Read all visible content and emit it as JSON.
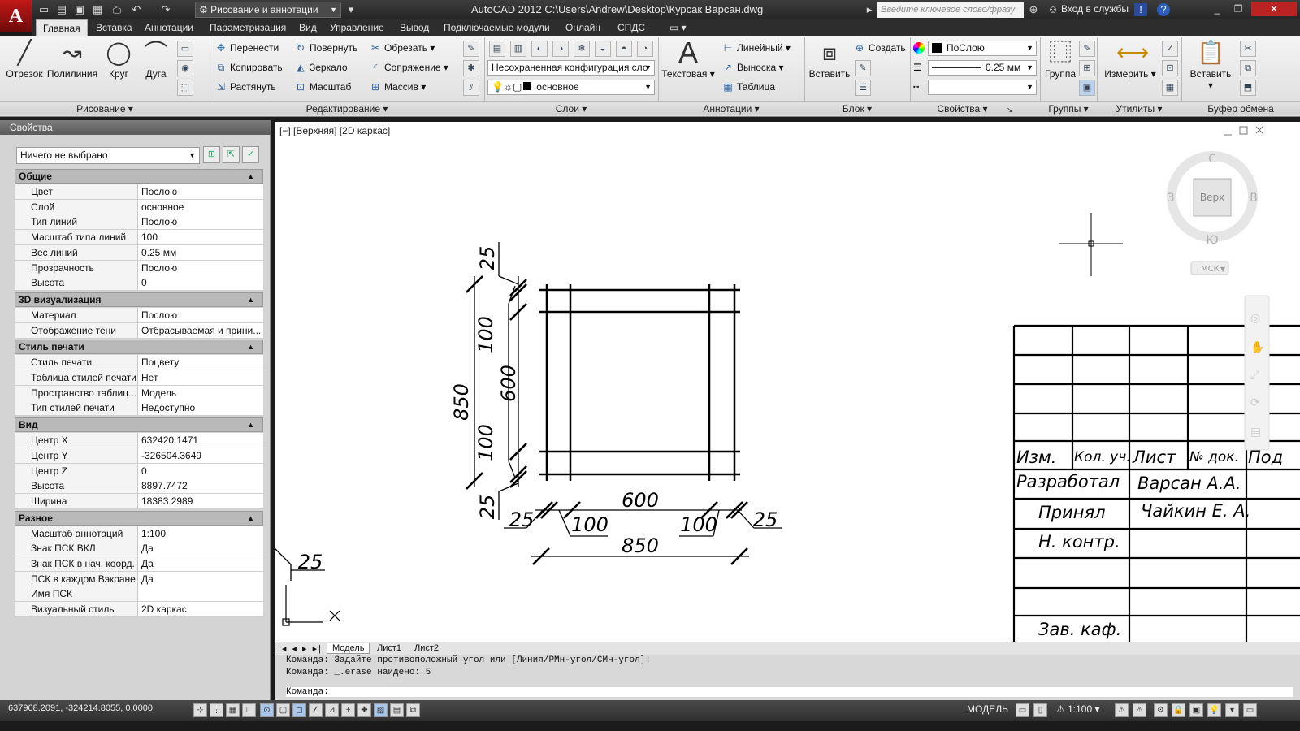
{
  "app": {
    "logo": "A",
    "title": "AutoCAD 2012    C:\\Users\\Andrew\\Desktop\\Курсак Варсан.dwg",
    "workspace": "Рисование и аннотации",
    "search_placeholder": "Введите ключевое слово/фразу",
    "sign_in": "Вход в службы"
  },
  "menu": {
    "tabs": [
      "Главная",
      "Вставка",
      "Аннотации",
      "Параметризация",
      "Вид",
      "Управление",
      "Вывод",
      "Подключаемые модули",
      "Онлайн",
      "СПДС"
    ]
  },
  "ribbon": {
    "draw": {
      "title": "Рисование",
      "line": "Отрезок",
      "polyline": "Полилиния",
      "circle": "Круг",
      "arc": "Дуга"
    },
    "modify": {
      "title": "Редактирование",
      "move": "Перенести",
      "rotate": "Повернуть",
      "trim": "Обрезать",
      "copy": "Копировать",
      "mirror": "Зеркало",
      "fillet": "Сопряжение",
      "stretch": "Растянуть",
      "scale": "Масштаб",
      "array": "Массив"
    },
    "layers": {
      "title": "Слои",
      "state": "Несохраненная конфигурация сло",
      "current": "основное"
    },
    "annotation": {
      "title": "Аннотации",
      "text": "Текстовая",
      "linear": "Линейный",
      "leader": "Выноска",
      "table": "Таблица"
    },
    "block": {
      "title": "Блок",
      "insert": "Вставить",
      "create": "Создать"
    },
    "properties": {
      "title": "Свойства",
      "color": "ПоСлою",
      "lineweight": "0.25 мм"
    },
    "groups": {
      "title": "Группы",
      "group": "Группа"
    },
    "utilities": {
      "title": "Утилиты",
      "measure": "Измерить"
    },
    "clipboard": {
      "title": "Буфер обмена",
      "paste": "Вставить"
    }
  },
  "palette": {
    "title": "Свойства",
    "selection": "Ничего не выбрано",
    "sections": [
      {
        "name": "Общие",
        "rows": [
          [
            "Цвет",
            "Послою"
          ],
          [
            "Слой",
            "основное"
          ],
          [
            "Тип линий",
            "Послою"
          ],
          [
            "Масштаб типа линий",
            "100"
          ],
          [
            "Вес линий",
            "0.25 мм"
          ],
          [
            "Прозрачность",
            "Послою"
          ],
          [
            "Высота",
            "0"
          ]
        ]
      },
      {
        "name": "3D визуализация",
        "rows": [
          [
            "Материал",
            "Послою"
          ],
          [
            "Отображение тени",
            "Отбрасываемая и прини..."
          ]
        ]
      },
      {
        "name": "Стиль печати",
        "rows": [
          [
            "Стиль печати",
            "Поцвету"
          ],
          [
            "Таблица стилей печати",
            "Нет"
          ],
          [
            "Пространство таблиц...",
            "Модель"
          ],
          [
            "Тип стилей печати",
            "Недоступно"
          ]
        ]
      },
      {
        "name": "Вид",
        "rows": [
          [
            "Центр X",
            "632420.1471"
          ],
          [
            "Центр Y",
            "-326504.3649"
          ],
          [
            "Центр Z",
            "0"
          ],
          [
            "Высота",
            "8897.7472"
          ],
          [
            "Ширина",
            "18383.2989"
          ]
        ]
      },
      {
        "name": "Разное",
        "rows": [
          [
            "Масштаб аннотаций",
            "1:100"
          ],
          [
            "Знак ПСК ВКЛ",
            "Да"
          ],
          [
            "Знак ПСК в нач. коорд.",
            "Да"
          ],
          [
            "ПСК в каждом Вэкране",
            "Да"
          ],
          [
            "Имя ПСК",
            ""
          ],
          [
            "Визуальный стиль",
            "2D каркас"
          ]
        ]
      }
    ]
  },
  "viewport": {
    "label": "[−] [Верхняя] [2D каркас]",
    "viewcube": {
      "top": "Верх",
      "north": "С",
      "south": "Ю",
      "west": "З",
      "east": "В",
      "wcs": "МСК"
    },
    "dims": {
      "left_total": "850",
      "left_mid": "600",
      "left_a": "100",
      "left_b": "100",
      "left_c": "25",
      "left_d": "25",
      "bottom_mid": "600",
      "bottom_a": "100",
      "bottom_b": "100",
      "bottom_c": "25",
      "bottom_d": "25",
      "bottom_total": "850",
      "partial": "25"
    },
    "titleblock": {
      "izm": "Изм.",
      "kol": "Кол. уч.",
      "list": "Лист",
      "doc": "№ док.",
      "pod": "Под",
      "dev_label": "Разработал",
      "dev_name": "Варсан А.А.",
      "acc_label": "Принял",
      "acc_name": "Чайкин Е. А.",
      "norm": "Н. контр.",
      "head": "Зав. каф."
    }
  },
  "layout_tabs": [
    "Модель",
    "Лист1",
    "Лист2"
  ],
  "command": {
    "lines": [
      "Команда: Задайте противоположный угол или [Линия/РМн-угол/СМн-угол]:",
      "Команда: _.erase найдено: 5"
    ],
    "prompt": "Команда:"
  },
  "status": {
    "coords": "637908.2091, -324214.8055, 0.0000",
    "mode": "МОДЕЛЬ",
    "scale": "1:100"
  }
}
